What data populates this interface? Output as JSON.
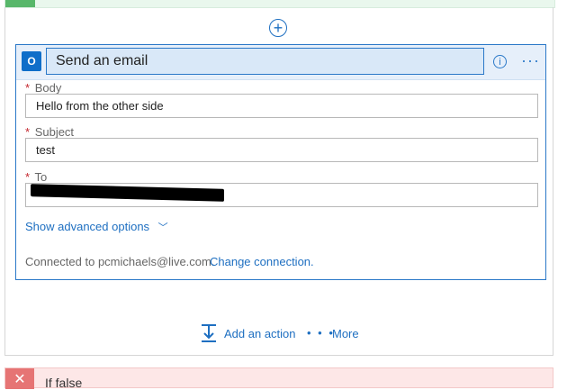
{
  "top": {
    "add_step_symbol": "+"
  },
  "card": {
    "title": "Send an email",
    "info_symbol": "i",
    "more_symbol": "···",
    "icon": "outlook-icon"
  },
  "fields": {
    "body": {
      "label": "Body",
      "value": "Hello from the other side",
      "required_mark": "*"
    },
    "subject": {
      "label": "Subject",
      "value": "test",
      "required_mark": "*"
    },
    "to": {
      "label": "To",
      "value": "",
      "required_mark": "*"
    }
  },
  "advanced": {
    "label": "Show advanced options",
    "chevron": "﹀"
  },
  "connection": {
    "text": "Connected to pcmichaels@live.com.",
    "change_label": "Change connection."
  },
  "actions": {
    "add_action_label": "Add an action",
    "more_dots": "• • •",
    "more_label": "More"
  },
  "if_false": {
    "label": "If false",
    "symbol": "✕"
  },
  "colors": {
    "accent": "#1e6fc1",
    "header_bg": "#e6effa",
    "success_band": "#e9f7ed",
    "false_band": "#fde7e7"
  }
}
